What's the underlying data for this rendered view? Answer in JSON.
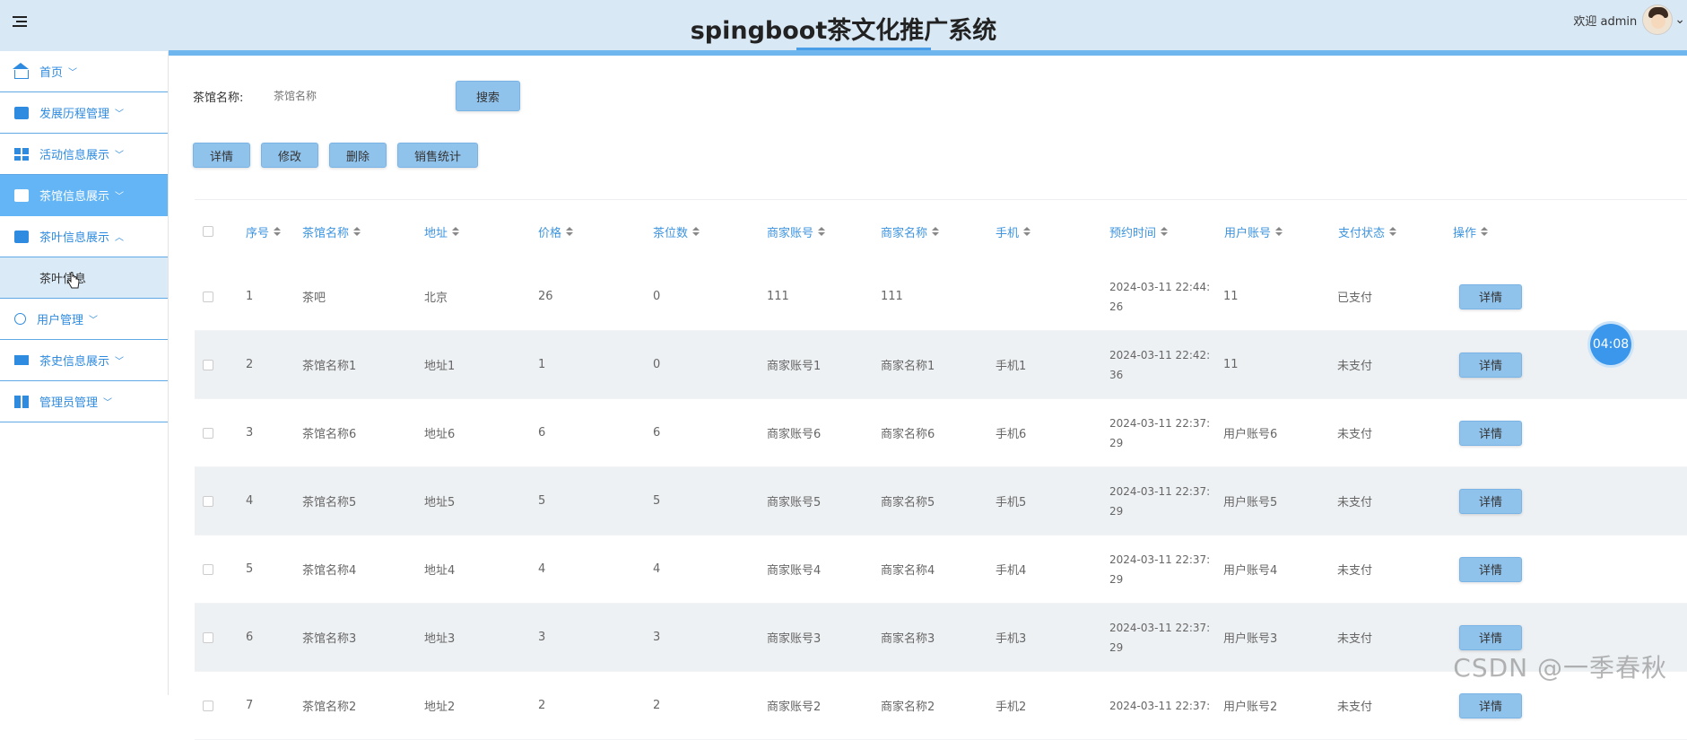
{
  "header": {
    "title": "spingboot茶文化推广系统",
    "welcome": "欢迎 admin"
  },
  "sidebar": {
    "items": [
      {
        "label": "首页",
        "icon": "home-icon"
      },
      {
        "label": "发展历程管理",
        "icon": "archive-icon"
      },
      {
        "label": "活动信息展示",
        "icon": "dashboard-icon"
      },
      {
        "label": "茶馆信息展示",
        "icon": "archive-icon",
        "active": true
      },
      {
        "label": "茶叶信息展示",
        "icon": "monitor-icon",
        "expanded": true
      },
      {
        "label": "用户管理",
        "icon": "medal-icon"
      },
      {
        "label": "茶史信息展示",
        "icon": "screen-icon"
      },
      {
        "label": "管理员管理",
        "icon": "book-icon"
      }
    ],
    "sub_item": "茶叶信息"
  },
  "search": {
    "label": "茶馆名称:",
    "placeholder": "茶馆名称",
    "button": "搜索"
  },
  "actions": {
    "detail": "详情",
    "edit": "修改",
    "delete": "删除",
    "stats": "销售统计"
  },
  "table": {
    "headers": [
      "序号",
      "茶馆名称",
      "地址",
      "价格",
      "茶位数",
      "商家账号",
      "商家名称",
      "手机",
      "预约时间",
      "用户账号",
      "支付状态",
      "操作"
    ],
    "rows": [
      {
        "no": "1",
        "name": "茶吧",
        "addr": "北京",
        "price": "26",
        "seats": "0",
        "macc": "111",
        "mname": "111",
        "phone": "",
        "time1": "2024-03-11 22:44:",
        "time2": "26",
        "uacc": "11",
        "pay": "已支付",
        "op": "详情"
      },
      {
        "no": "2",
        "name": "茶馆名称1",
        "addr": "地址1",
        "price": "1",
        "seats": "0",
        "macc": "商家账号1",
        "mname": "商家名称1",
        "phone": "手机1",
        "time1": "2024-03-11 22:42:",
        "time2": "36",
        "uacc": "11",
        "pay": "未支付",
        "op": "详情"
      },
      {
        "no": "3",
        "name": "茶馆名称6",
        "addr": "地址6",
        "price": "6",
        "seats": "6",
        "macc": "商家账号6",
        "mname": "商家名称6",
        "phone": "手机6",
        "time1": "2024-03-11 22:37:",
        "time2": "29",
        "uacc": "用户账号6",
        "pay": "未支付",
        "op": "详情"
      },
      {
        "no": "4",
        "name": "茶馆名称5",
        "addr": "地址5",
        "price": "5",
        "seats": "5",
        "macc": "商家账号5",
        "mname": "商家名称5",
        "phone": "手机5",
        "time1": "2024-03-11 22:37:",
        "time2": "29",
        "uacc": "用户账号5",
        "pay": "未支付",
        "op": "详情"
      },
      {
        "no": "5",
        "name": "茶馆名称4",
        "addr": "地址4",
        "price": "4",
        "seats": "4",
        "macc": "商家账号4",
        "mname": "商家名称4",
        "phone": "手机4",
        "time1": "2024-03-11 22:37:",
        "time2": "29",
        "uacc": "用户账号4",
        "pay": "未支付",
        "op": "详情"
      },
      {
        "no": "6",
        "name": "茶馆名称3",
        "addr": "地址3",
        "price": "3",
        "seats": "3",
        "macc": "商家账号3",
        "mname": "商家名称3",
        "phone": "手机3",
        "time1": "2024-03-11 22:37:",
        "time2": "29",
        "uacc": "用户账号3",
        "pay": "未支付",
        "op": "详情"
      },
      {
        "no": "7",
        "name": "茶馆名称2",
        "addr": "地址2",
        "price": "2",
        "seats": "2",
        "macc": "商家账号2",
        "mname": "商家名称2",
        "phone": "手机2",
        "time1": "2024-03-11 22:37:",
        "time2": "",
        "uacc": "用户账号2",
        "pay": "未支付",
        "op": "详情"
      }
    ]
  },
  "timer": "04:08",
  "watermark": "CSDN @一季春秋",
  "colors": {
    "accent": "#64b5f6",
    "header_bg": "#d9e8f5",
    "button": "#90c3ec",
    "link": "#3d94e0"
  }
}
